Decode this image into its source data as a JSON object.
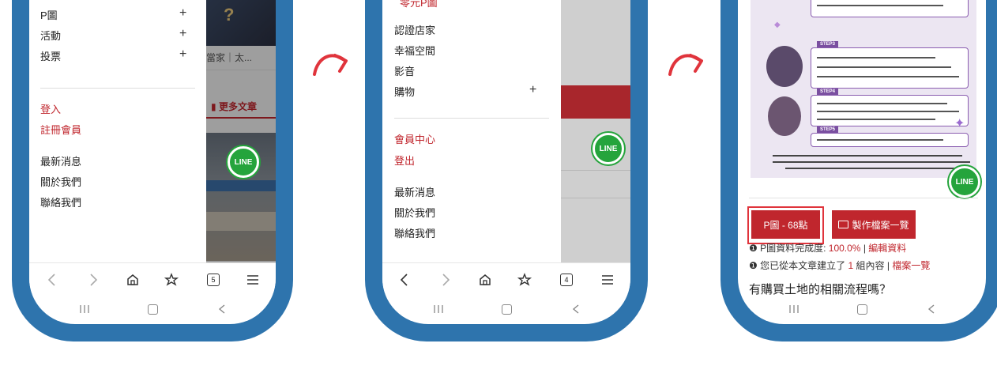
{
  "phone1": {
    "menu": [
      {
        "label": "P圖",
        "expandable": true
      },
      {
        "label": "活動",
        "expandable": true
      },
      {
        "label": "投票",
        "expandable": true
      }
    ],
    "auth": [
      "登入",
      "註冊會員"
    ],
    "links": [
      "最新消息",
      "關於我們",
      "聯絡我們"
    ],
    "bg_text_1": "當家｜太...",
    "bg_more": "更多文章",
    "nav_tab_count": "5"
  },
  "phone2": {
    "top_item": "零元P圖",
    "menu": [
      {
        "label": "認證店家",
        "expandable": false
      },
      {
        "label": "幸福空間",
        "expandable": false
      },
      {
        "label": "影音",
        "expandable": false
      },
      {
        "label": "購物",
        "expandable": true
      }
    ],
    "auth": [
      "會員中心",
      "登出"
    ],
    "links": [
      "最新消息",
      "關於我們",
      "聯絡我們"
    ],
    "nav_tab_count": "4"
  },
  "phone3": {
    "steps": [
      "STEP3",
      "STEP4",
      "STEP5"
    ],
    "button_primary": "P圖 - 68點",
    "button_secondary": "製作檔案一覽",
    "info1_prefix": "P圖資料完成度:",
    "info1_value": "100.0%",
    "info1_sep": "|",
    "info1_link": "編輯資料",
    "info2_prefix": "您已從本文章建立了",
    "info2_count": "1",
    "info2_suffix": "組內容",
    "info2_sep": "|",
    "info2_link": "檔案一覽",
    "question": "有購買土地的相關流程嗎？"
  },
  "line_badge_text": "LINE",
  "icons": [
    "back-icon",
    "forward-icon",
    "home-icon",
    "bookmark-star-icon",
    "tabs-icon",
    "menu-icon",
    "recents-icon",
    "home-button-icon",
    "back-button-icon"
  ],
  "colors": {
    "frame": "#2e74ad",
    "accent_red": "#c0262d",
    "line_green": "#25a43c"
  }
}
